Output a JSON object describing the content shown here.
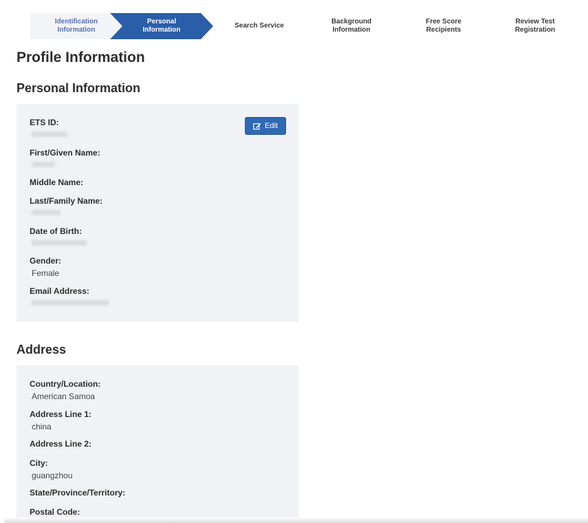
{
  "steps": [
    {
      "label": "Identification\nInformation",
      "line1": "Identification",
      "line2": "Information"
    },
    {
      "line1": "Personal",
      "line2": "Information"
    },
    {
      "line1": "Search Service",
      "line2": ""
    },
    {
      "line1": "Background",
      "line2": "Information"
    },
    {
      "line1": "Free Score",
      "line2": "Recipients"
    },
    {
      "line1": "Review Test",
      "line2": "Registration"
    }
  ],
  "page_title": "Profile Information",
  "personal": {
    "heading": "Personal Information",
    "edit_label": "Edit",
    "fields": [
      {
        "label": "ETS ID:",
        "value": ""
      },
      {
        "label": "First/Given Name:",
        "value": ""
      },
      {
        "label": "Middle Name:",
        "value": ""
      },
      {
        "label": "Last/Family Name:",
        "value": ""
      },
      {
        "label": "Date of Birth:",
        "value": ""
      },
      {
        "label": "Gender:",
        "value": "Female"
      },
      {
        "label": "Email Address:",
        "value": ""
      }
    ]
  },
  "address": {
    "heading": "Address",
    "fields": [
      {
        "label": "Country/Location:",
        "value": "American Samoa"
      },
      {
        "label": "Address Line 1:",
        "value": "china"
      },
      {
        "label": "Address Line 2:",
        "value": ""
      },
      {
        "label": "City:",
        "value": "guangzhou"
      },
      {
        "label": "State/Province/Territory:",
        "value": ""
      },
      {
        "label": "Postal Code:",
        "value": ""
      }
    ]
  },
  "colors": {
    "accent": "#2a5ea8",
    "panel": "#f1f2f5",
    "step_done_text": "#5a6fb0"
  }
}
